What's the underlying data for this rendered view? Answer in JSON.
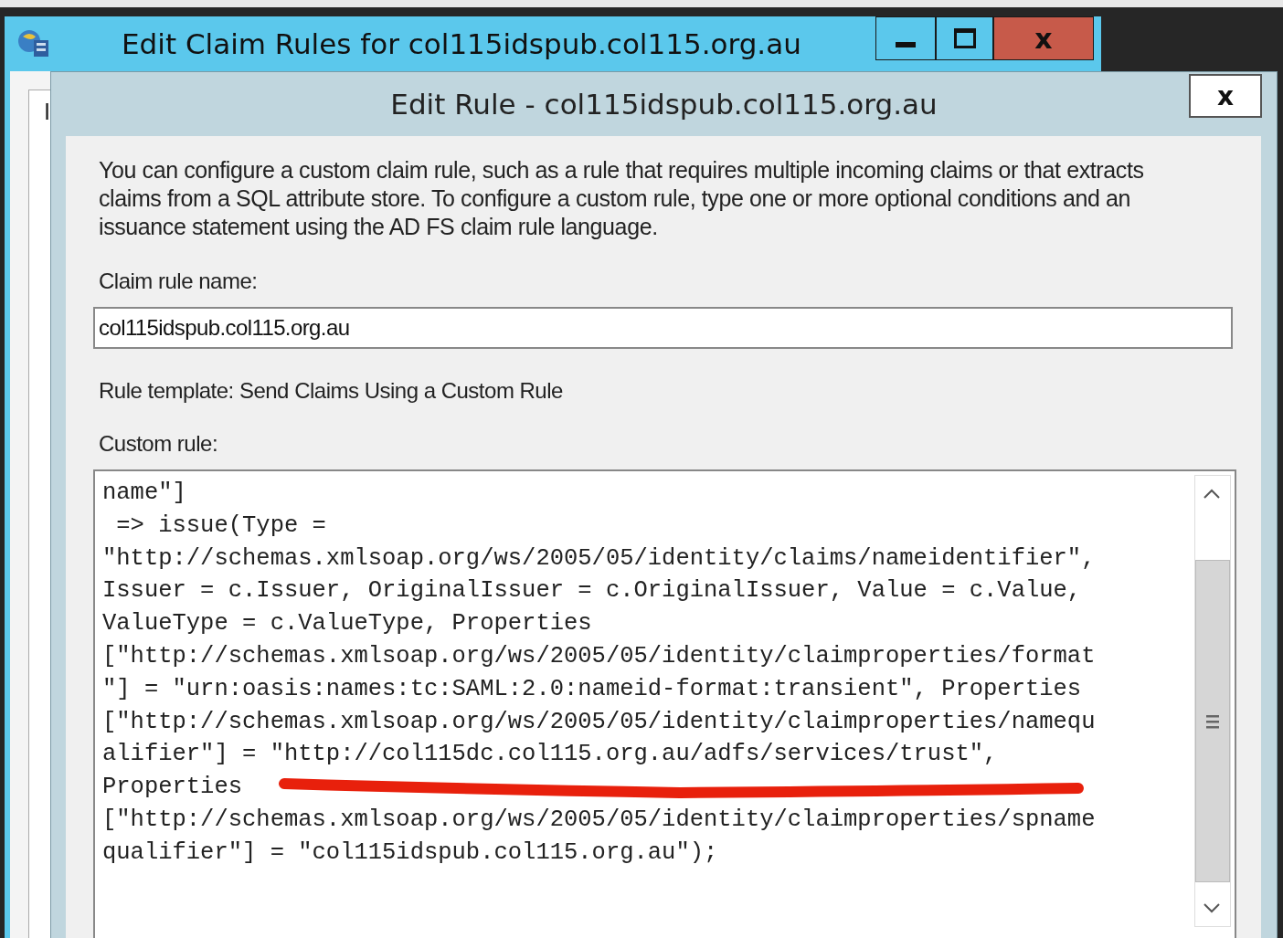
{
  "back_window": {
    "title": "Edit Claim Rules for col115idspub.col115.org.au",
    "body_fragment": "I",
    "buttons": [
      {
        "kind": "minimize"
      },
      {
        "kind": "maximize"
      },
      {
        "kind": "close",
        "label": "x"
      }
    ]
  },
  "dialog": {
    "title": "Edit Rule - col115idspub.col115.org.au",
    "close_label": "x",
    "description": "You can configure a custom claim rule, such as a rule that requires multiple incoming claims or that extracts claims from a SQL attribute store. To configure a custom rule, type one or more optional conditions and an issuance statement using the AD FS claim rule language.",
    "name_label": "Claim rule name:",
    "name_value": "col115idspub.col115.org.au",
    "template_text": "Rule template: Send Claims Using a Custom Rule",
    "custom_rule_label": "Custom rule:",
    "custom_rule_lines": [
      "name\"]",
      " => issue(Type =",
      "\"http://schemas.xmlsoap.org/ws/2005/05/identity/claims/nameidentifier\",",
      "Issuer = c.Issuer, OriginalIssuer = c.OriginalIssuer, Value = c.Value,",
      "ValueType = c.ValueType, Properties",
      "[\"http://schemas.xmlsoap.org/ws/2005/05/identity/claimproperties/format",
      "\"] = \"urn:oasis:names:tc:SAML:2.0:nameid-format:transient\", Properties",
      "[\"http://schemas.xmlsoap.org/ws/2005/05/identity/claimproperties/namequ",
      "alifier\"] = \"http://col115dc.col115.org.au/adfs/services/trust\",",
      "Properties",
      "[\"http://schemas.xmlsoap.org/ws/2005/05/identity/claimproperties/spname",
      "qualifier\"] = \"col115idspub.col115.org.au\");"
    ]
  }
}
